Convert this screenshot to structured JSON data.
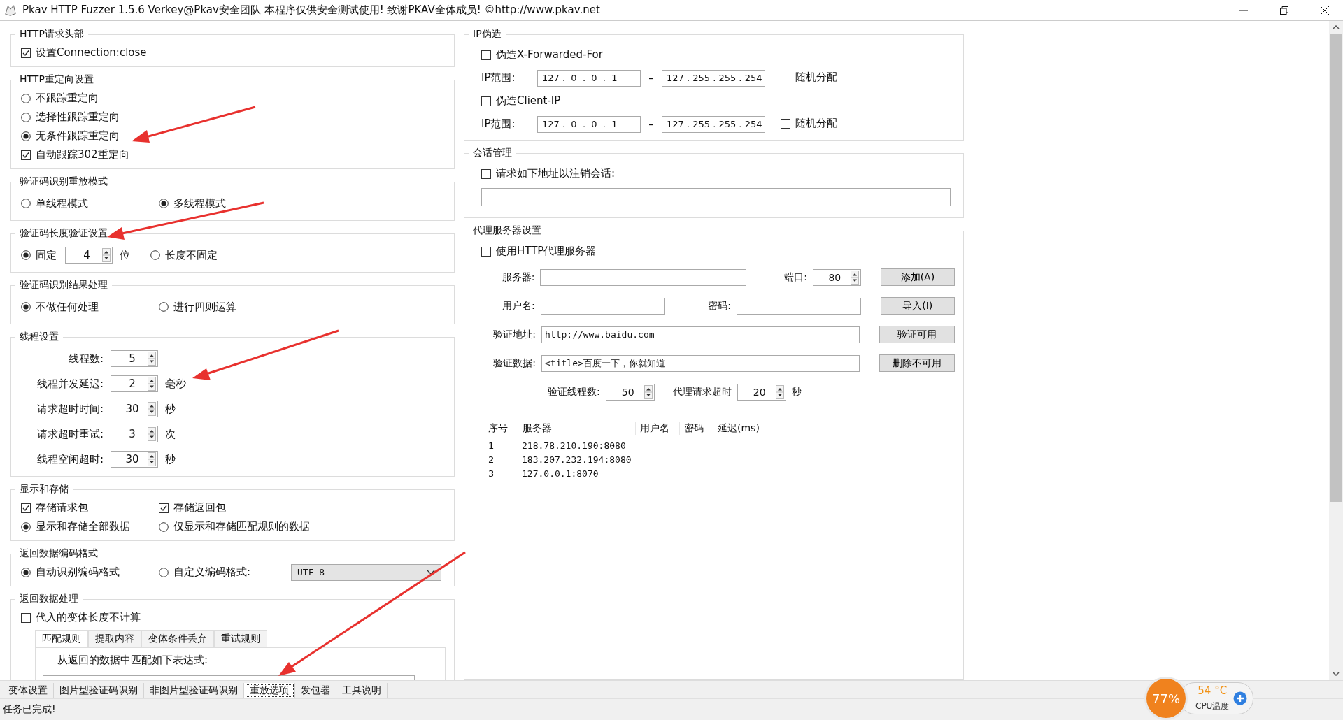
{
  "window": {
    "title": "Pkav HTTP Fuzzer 1.5.6  Verkey@Pkav安全团队  本程序仅供安全测试使用!  致谢PKAV全体成员! ©http://www.pkav.net"
  },
  "left_panel": {
    "groups": [
      {
        "title": "HTTP请求头部",
        "rows": [
          [
            {
              "kind": "checkbox",
              "label": "设置Connection:close",
              "checked": true
            }
          ]
        ]
      },
      {
        "title": "HTTP重定向设置",
        "rows": [
          [
            {
              "kind": "radio",
              "label": "不跟踪重定向",
              "selected": false
            }
          ],
          [
            {
              "kind": "radio",
              "label": "选择性跟踪重定向",
              "selected": false
            }
          ],
          [
            {
              "kind": "radio",
              "label": "无条件跟踪重定向",
              "selected": true
            }
          ],
          [
            {
              "kind": "checkbox",
              "label": "自动跟踪302重定向",
              "checked": true
            }
          ]
        ]
      },
      {
        "title": "验证码识别重放模式",
        "rows": [
          [
            {
              "kind": "radio",
              "label": "单线程模式",
              "selected": false
            },
            {
              "kind": "radio",
              "label": "多线程模式",
              "selected": true
            }
          ]
        ]
      },
      {
        "title": "验证码长度验证设置",
        "rows": [
          [
            {
              "kind": "radio",
              "label": "固定",
              "selected": true
            },
            {
              "kind": "spin",
              "value": "4",
              "unit": "位"
            },
            {
              "kind": "radio",
              "label": "长度不固定",
              "selected": false
            }
          ]
        ]
      },
      {
        "title": "验证码识别结果处理",
        "rows": [
          [
            {
              "kind": "radio",
              "label": "不做任何处理",
              "selected": true
            },
            {
              "kind": "radio",
              "label": "进行四则运算",
              "selected": false
            }
          ]
        ]
      },
      {
        "title": "线程设置",
        "rows": [
          [
            {
              "kind": "spin",
              "label": "线程数:",
              "value": "5"
            }
          ],
          [
            {
              "kind": "spin",
              "label": "线程并发延迟:",
              "value": "2",
              "unit": "毫秒"
            }
          ],
          [
            {
              "kind": "spin",
              "label": "请求超时时间:",
              "value": "30",
              "unit": "秒"
            }
          ],
          [
            {
              "kind": "spin",
              "label": "请求超时重试:",
              "value": "3",
              "unit": "次"
            }
          ],
          [
            {
              "kind": "spin",
              "label": "线程空闲超时:",
              "value": "30",
              "unit": "秒"
            }
          ]
        ]
      },
      {
        "title": "显示和存储",
        "rows": [
          [
            {
              "kind": "checkbox",
              "label": "存储请求包",
              "checked": true
            },
            {
              "kind": "checkbox",
              "label": "存储返回包",
              "checked": true
            }
          ],
          [
            {
              "kind": "radio",
              "label": "显示和存储全部数据",
              "selected": true
            },
            {
              "kind": "radio",
              "label": "仅显示和存储匹配规则的数据",
              "selected": false
            }
          ]
        ]
      },
      {
        "title": "返回数据编码格式",
        "rows": [
          [
            {
              "kind": "radio",
              "label": "自动识别编码格式",
              "selected": true
            },
            {
              "kind": "radio",
              "label": "自定义编码格式:",
              "selected": false
            },
            {
              "kind": "select",
              "value": "UTF-8"
            }
          ]
        ]
      },
      {
        "title": "返回数据处理",
        "rows": [
          [
            {
              "kind": "checkbox",
              "label": "代入的变体长度不计算",
              "checked": false
            }
          ]
        ],
        "tabs": [
          {
            "label": "匹配规则",
            "selected": true
          },
          {
            "label": "提取内容",
            "selected": false
          },
          {
            "label": "变体条件丢弃",
            "selected": false
          },
          {
            "label": "重试规则",
            "selected": false
          }
        ],
        "tab_content": {
          "kind": "checkbox",
          "label": "从返回的数据中匹配如下表达式:",
          "checked": false
        }
      }
    ]
  },
  "ip_spoof": {
    "title": "IP伪造",
    "entries": [
      {
        "label": "伪造X-Forwarded-For",
        "checked": false,
        "range_label": "IP范围:",
        "from": "127 .  0  .  0  .  1",
        "separator": "–",
        "to": "127 . 255 . 255 . 254",
        "random": {
          "label": "随机分配",
          "checked": false
        }
      },
      {
        "label": "伪造Client-IP",
        "checked": false,
        "range_label": "IP范围:",
        "from": "127 .  0  .  0  .  1",
        "separator": "–",
        "to": "127 . 255 . 255 . 254",
        "random": {
          "label": "随机分配",
          "checked": false
        }
      }
    ]
  },
  "session": {
    "title": "会话管理",
    "option": {
      "label": "请求如下地址以注销会话:",
      "checked": false
    }
  },
  "proxy": {
    "title": "代理服务器设置",
    "use_proxy": {
      "label": "使用HTTP代理服务器",
      "checked": false
    },
    "server_label": "服务器:",
    "port_label": "端口:",
    "port": "80",
    "username_label": "用户名:",
    "password_label": "密码:",
    "verify_url_label": "验证地址:",
    "verify_url": "http://www.baidu.com",
    "verify_data_label": "验证数据:",
    "verify_data": "<title>百度一下，你就知道",
    "buttons": [
      "添加(A)",
      "导入(I)",
      "验证可用",
      "删除不可用"
    ],
    "threads_label": "验证线程数:",
    "threads": "50",
    "timeout_label": "代理请求超时",
    "timeout": "20",
    "timeout_unit": "秒",
    "table": {
      "columns": [
        "序号",
        "服务器",
        "用户名",
        "密码",
        "延迟(ms)"
      ],
      "rows": [
        {
          "index": "1",
          "server": "218.78.210.190:8080"
        },
        {
          "index": "2",
          "server": "183.207.232.194:8080"
        },
        {
          "index": "3",
          "server": "127.0.0.1:8070"
        }
      ]
    }
  },
  "bottom_tabs": [
    {
      "label": "变体设置",
      "selected": false
    },
    {
      "label": "图片型验证码识别",
      "selected": false
    },
    {
      "label": "非图片型验证码识别",
      "selected": false
    },
    {
      "label": "重放选项",
      "selected": true
    },
    {
      "label": "发包器",
      "selected": false
    },
    {
      "label": "工具说明",
      "selected": false
    }
  ],
  "status_bar": "任务已完成!",
  "cpu_widget": {
    "load": "77%",
    "temperature": "54 °C",
    "label": "CPU温度"
  }
}
